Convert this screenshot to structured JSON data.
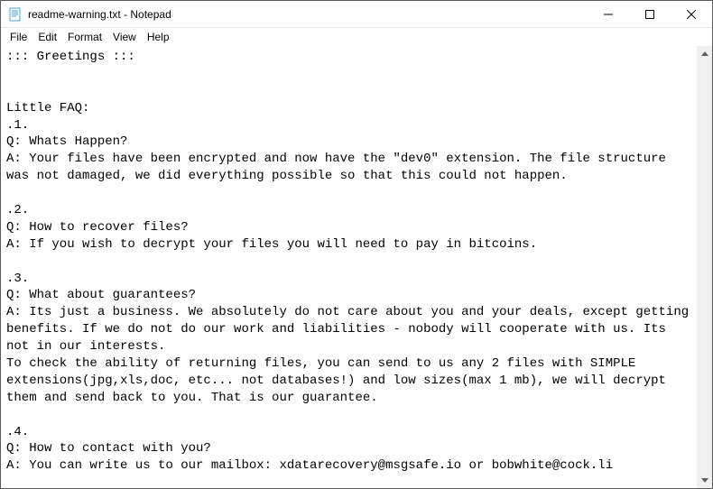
{
  "window": {
    "title": "readme-warning.txt - Notepad",
    "controls": {
      "minimize": "—",
      "maximize": "▢",
      "close": "✕"
    }
  },
  "menubar": {
    "items": [
      "File",
      "Edit",
      "Format",
      "View",
      "Help"
    ]
  },
  "document": {
    "text": "::: Greetings :::\n\n\nLittle FAQ:\n.1.\nQ: Whats Happen?\nA: Your files have been encrypted and now have the \"dev0\" extension. The file structure was not damaged, we did everything possible so that this could not happen.\n\n.2.\nQ: How to recover files?\nA: If you wish to decrypt your files you will need to pay in bitcoins.\n\n.3.\nQ: What about guarantees?\nA: Its just a business. We absolutely do not care about you and your deals, except getting benefits. If we do not do our work and liabilities - nobody will cooperate with us. Its not in our interests.\nTo check the ability of returning files, you can send to us any 2 files with SIMPLE extensions(jpg,xls,doc, etc... not databases!) and low sizes(max 1 mb), we will decrypt them and send back to you. That is our guarantee.\n\n.4.\nQ: How to contact with you?\nA: You can write us to our mailbox: xdatarecovery@msgsafe.io or bobwhite@cock.li"
  },
  "scrollbar": {
    "up": "▲",
    "down": "▼"
  }
}
